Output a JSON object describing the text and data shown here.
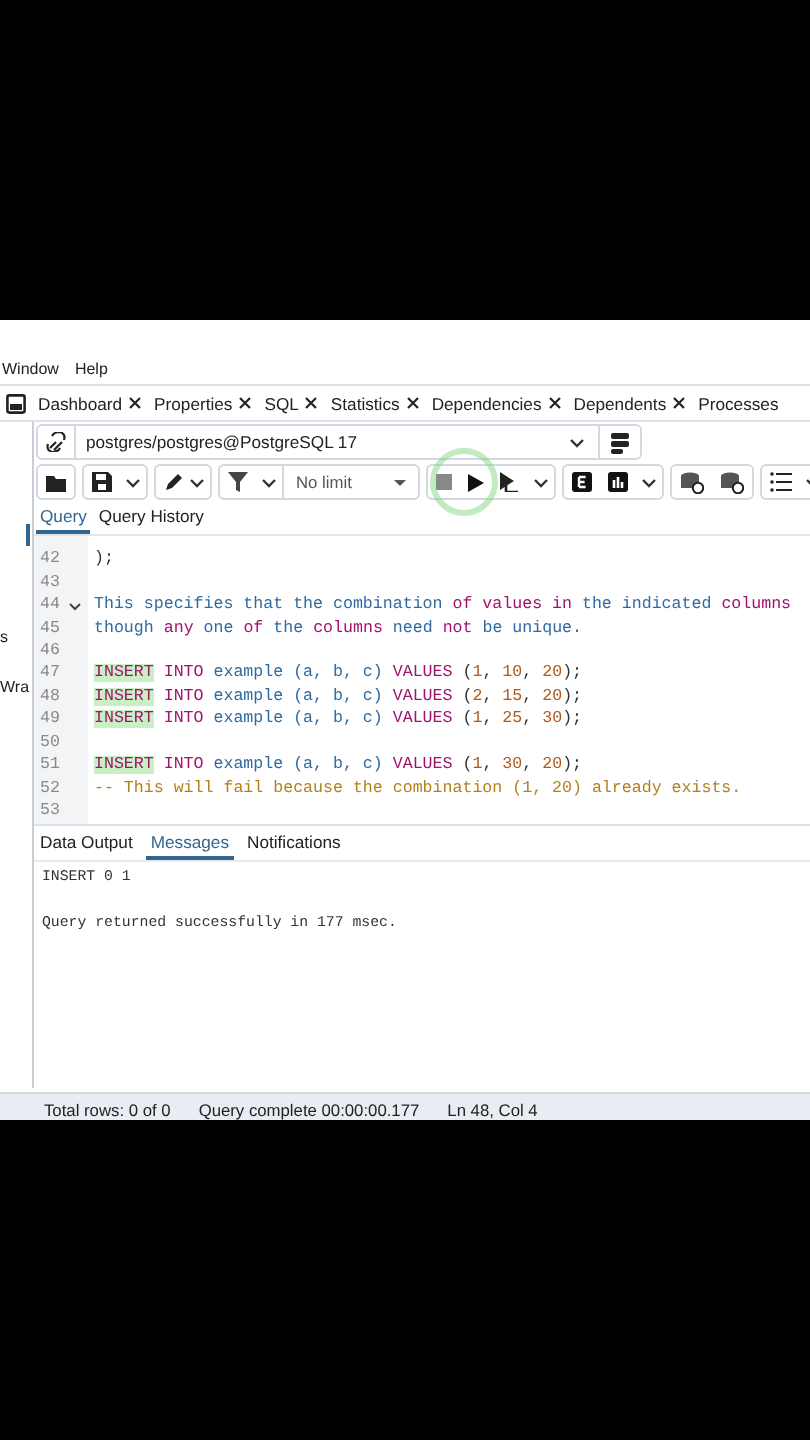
{
  "menu": [
    "Window",
    "Help"
  ],
  "sidebar": {
    "labels": [
      "s",
      "Wra"
    ]
  },
  "sheet_tabs": [
    {
      "label": "Dashboard",
      "closable": true
    },
    {
      "label": "Properties",
      "closable": true
    },
    {
      "label": "SQL",
      "closable": true
    },
    {
      "label": "Statistics",
      "closable": true
    },
    {
      "label": "Dependencies",
      "closable": true
    },
    {
      "label": "Dependents",
      "closable": true
    },
    {
      "label": "Processes",
      "closable": false
    }
  ],
  "connection": {
    "label": "postgres/postgres@PostgreSQL 17"
  },
  "toolbar": {
    "row_limit": "No limit"
  },
  "query_tabs": [
    {
      "label": "Query",
      "selected": true
    },
    {
      "label": "Query History",
      "selected": false
    }
  ],
  "editor": {
    "lines": [
      {
        "number": "42",
        "fold": false,
        "tokens": [
          {
            "text": ");",
            "kind": "punct"
          }
        ]
      },
      {
        "number": "43",
        "fold": false
      },
      {
        "number": "44",
        "fold": true,
        "tokens": [
          {
            "text": "This specifies that the combination ",
            "kind": "ident"
          },
          {
            "text": "of values in",
            "kind": "keyword"
          },
          {
            "text": " the indicated ",
            "kind": "ident"
          },
          {
            "text": "columns",
            "kind": "keyword"
          }
        ]
      },
      {
        "number": "45",
        "fold": false,
        "tokens": [
          {
            "text": "though ",
            "kind": "ident"
          },
          {
            "text": "any",
            "kind": "keyword"
          },
          {
            "text": " one ",
            "kind": "ident"
          },
          {
            "text": "of",
            "kind": "keyword"
          },
          {
            "text": " the ",
            "kind": "ident"
          },
          {
            "text": "columns",
            "kind": "keyword"
          },
          {
            "text": " need ",
            "kind": "ident"
          },
          {
            "text": "not",
            "kind": "keyword"
          },
          {
            "text": " be unique.",
            "kind": "ident"
          }
        ]
      },
      {
        "number": "46",
        "fold": false
      },
      {
        "number": "47",
        "fold": false,
        "tokens": [
          {
            "text": "INSERT",
            "kind": "match"
          },
          {
            "text": " INTO ",
            "kind": "keyword"
          },
          {
            "text": "example (a, b, c) ",
            "kind": "ident"
          },
          {
            "text": "VALUES",
            "kind": "keyword"
          },
          {
            "text": " (",
            "kind": "punct"
          },
          {
            "text": "1",
            "kind": "number"
          },
          {
            "text": ", ",
            "kind": "punct"
          },
          {
            "text": "10",
            "kind": "number"
          },
          {
            "text": ", ",
            "kind": "punct"
          },
          {
            "text": "20",
            "kind": "number"
          },
          {
            "text": ");",
            "kind": "punct"
          }
        ]
      },
      {
        "number": "48",
        "fold": false,
        "tokens": [
          {
            "text": "INSERT",
            "kind": "match"
          },
          {
            "text": " INTO ",
            "kind": "keyword"
          },
          {
            "text": "example (a, b, c) ",
            "kind": "ident"
          },
          {
            "text": "VALUES",
            "kind": "keyword"
          },
          {
            "text": " (",
            "kind": "punct"
          },
          {
            "text": "2",
            "kind": "number"
          },
          {
            "text": ", ",
            "kind": "punct"
          },
          {
            "text": "15",
            "kind": "number"
          },
          {
            "text": ", ",
            "kind": "punct"
          },
          {
            "text": "20",
            "kind": "number"
          },
          {
            "text": ");",
            "kind": "punct"
          }
        ]
      },
      {
        "number": "49",
        "fold": false,
        "tokens": [
          {
            "text": "INSERT",
            "kind": "match"
          },
          {
            "text": " INTO ",
            "kind": "keyword"
          },
          {
            "text": "example (a, b, c) ",
            "kind": "ident"
          },
          {
            "text": "VALUES",
            "kind": "keyword"
          },
          {
            "text": " (",
            "kind": "punct"
          },
          {
            "text": "1",
            "kind": "number"
          },
          {
            "text": ", ",
            "kind": "punct"
          },
          {
            "text": "25",
            "kind": "number"
          },
          {
            "text": ", ",
            "kind": "punct"
          },
          {
            "text": "30",
            "kind": "number"
          },
          {
            "text": ");",
            "kind": "punct"
          }
        ]
      },
      {
        "number": "50",
        "fold": false
      },
      {
        "number": "51",
        "fold": false,
        "tokens": [
          {
            "text": "INSERT",
            "kind": "match"
          },
          {
            "text": " INTO ",
            "kind": "keyword"
          },
          {
            "text": "example (a, b, c) ",
            "kind": "ident"
          },
          {
            "text": "VALUES",
            "kind": "keyword"
          },
          {
            "text": " (",
            "kind": "punct"
          },
          {
            "text": "1",
            "kind": "number"
          },
          {
            "text": ", ",
            "kind": "punct"
          },
          {
            "text": "30",
            "kind": "number"
          },
          {
            "text": ", ",
            "kind": "punct"
          },
          {
            "text": "20",
            "kind": "number"
          },
          {
            "text": ");",
            "kind": "punct"
          }
        ]
      },
      {
        "number": "52",
        "fold": false,
        "tokens": [
          {
            "text": "-- This will fail because the combination (1, 20) already exists.",
            "kind": "comment"
          }
        ]
      },
      {
        "number": "53",
        "fold": false
      }
    ]
  },
  "result_tabs": [
    {
      "label": "Data Output",
      "selected": false
    },
    {
      "label": "Messages",
      "selected": true
    },
    {
      "label": "Notifications",
      "selected": false
    }
  ],
  "messages": [
    "INSERT 0 1",
    "Query returned successfully in 177 msec."
  ],
  "status_bar": [
    "Total rows: 0 of 0",
    "Query complete 00:00:00.177",
    "Ln 48, Col 4"
  ]
}
